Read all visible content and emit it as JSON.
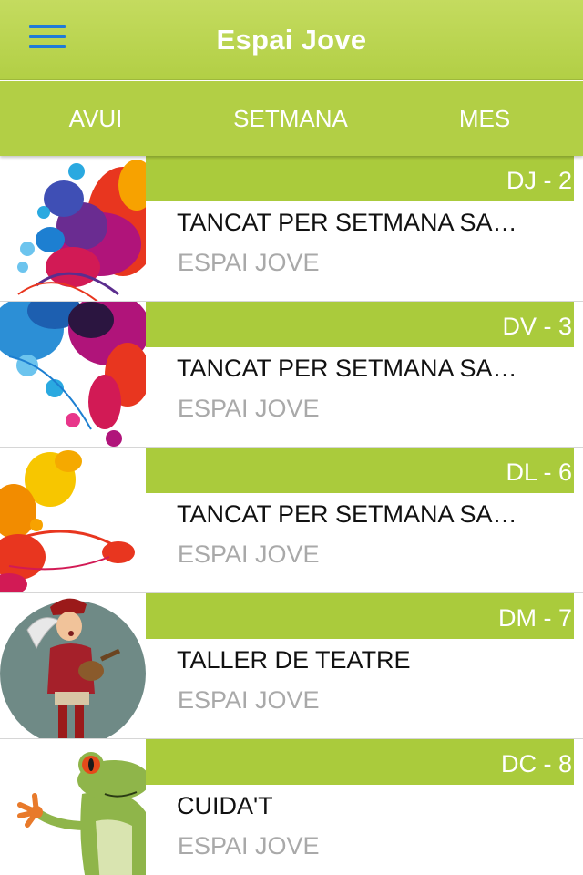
{
  "header": {
    "title": "Espai Jove",
    "menu_icon": "hamburger-icon",
    "accent": "#b2cf45"
  },
  "tabs": [
    {
      "label": "AVUI"
    },
    {
      "label": "SETMANA"
    },
    {
      "label": "MES"
    }
  ],
  "events": [
    {
      "date": "DJ - 2",
      "title": "TANCAT PER SETMANA SA…",
      "place": "ESPAI JOVE",
      "image": "colorful-splash-image"
    },
    {
      "date": "DV - 3",
      "title": "TANCAT PER SETMANA SA…",
      "place": "ESPAI JOVE",
      "image": "colorful-splash-image"
    },
    {
      "date": "DL - 6",
      "title": "TANCAT PER SETMANA SA…",
      "place": "ESPAI JOVE",
      "image": "colorful-splash-image"
    },
    {
      "date": "DM - 7",
      "title": "TALLER DE TEATRE",
      "place": "ESPAI JOVE",
      "image": "troubadour-image"
    },
    {
      "date": "DC - 8",
      "title": "CUIDA'T",
      "place": "ESPAI JOVE",
      "image": "frog-image"
    }
  ]
}
